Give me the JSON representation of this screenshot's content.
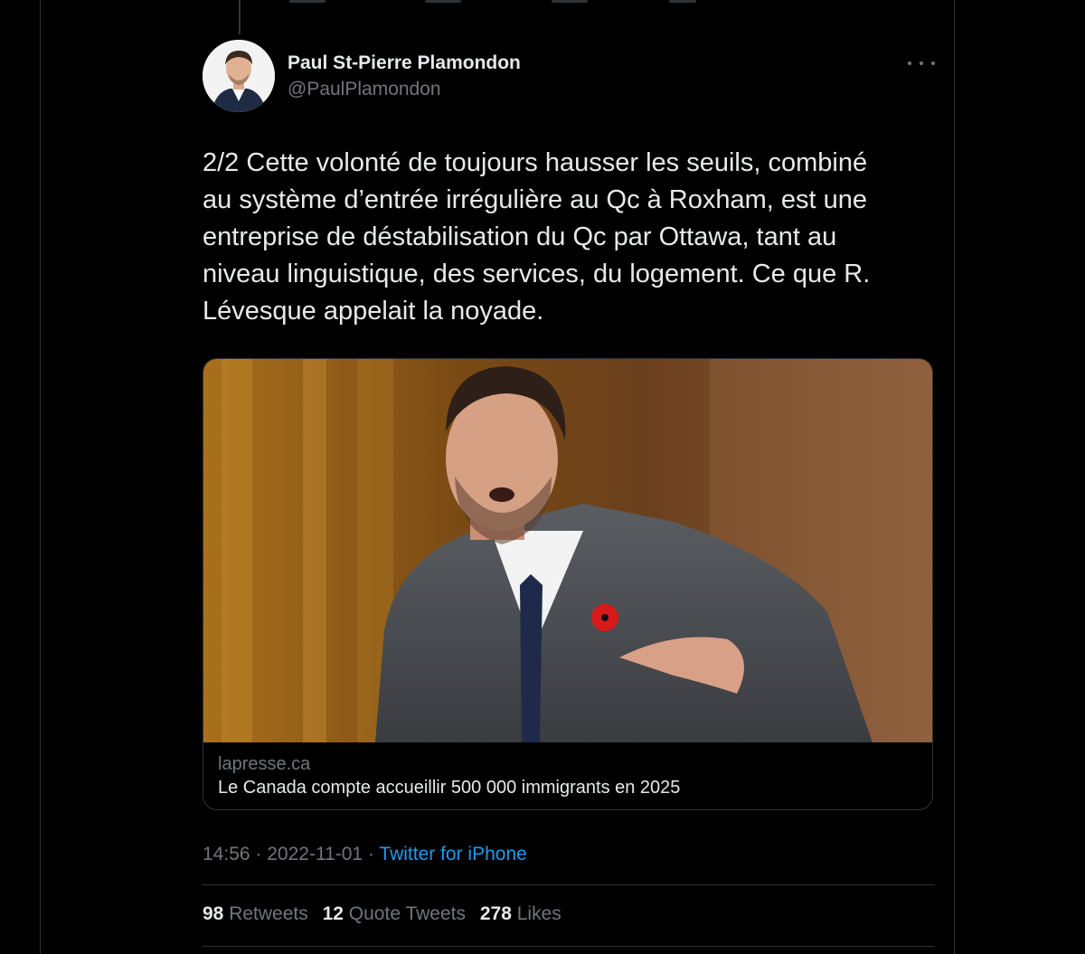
{
  "author": {
    "name": "Paul St-Pierre Plamondon",
    "handle": "@PaulPlamondon"
  },
  "tweet": {
    "text": "2/2 Cette volonté de toujours hausser les seuils, combiné\nau système d’entrée irrégulière au Qc à Roxham, est une\nentreprise de déstabilisation du Qc par Ottawa, tant au\nniveau linguistique, des services, du logement. Ce que R.\nLévesque appelait la noyade."
  },
  "link_card": {
    "domain": "lapresse.ca",
    "title": "Le Canada compte accueillir 500 000 immigrants en 2025",
    "image": "photo-of-man-speaking-in-parliament"
  },
  "meta": {
    "time": "14:56",
    "separator": " · ",
    "date": "2022-11-01",
    "source": "Twitter for iPhone"
  },
  "stats": {
    "retweets_count": "98",
    "retweets_label": "Retweets",
    "quotes_count": "12",
    "quotes_label": "Quote Tweets",
    "likes_count": "278",
    "likes_label": "Likes"
  },
  "icons": {
    "more": "more-options-icon"
  },
  "colors": {
    "background": "#000000",
    "text": "#e7e9ea",
    "secondary": "#71767b",
    "link": "#1d9bf0",
    "border": "#2f3336"
  }
}
